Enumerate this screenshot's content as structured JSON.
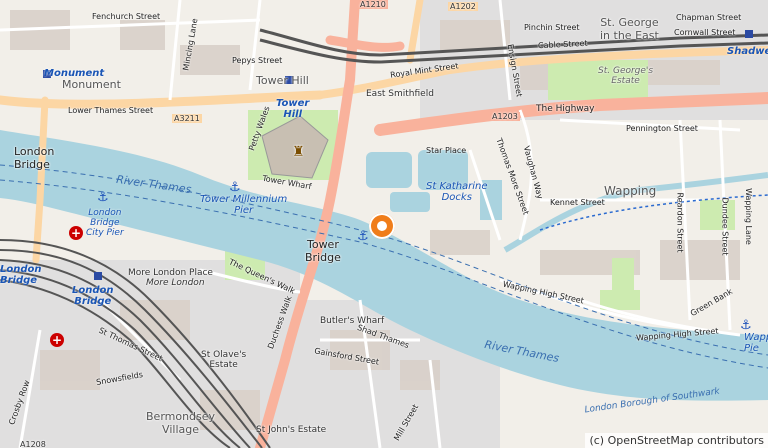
{
  "map": {
    "place_labels": {
      "monument_station": "Monument",
      "monument_area": "Monument",
      "london_bridge_area": "London\nBridge",
      "london_bridge_station": "London\nBridge",
      "london_bridge_city_pier": "London\nBridge\nCity Pier",
      "london_bridge_left": "London\nBridge",
      "tower_hill_area": "Tower Hill",
      "tower_hill_station": "Tower\nHill",
      "tower_bridge": "Tower\nBridge",
      "tower_millennium_pier": "Tower Millennium\nPier",
      "st_katharine_docks": "St Katharine\nDocks",
      "east_smithfield": "East Smithfield",
      "wapping": "Wapping",
      "st_george_in_the_east": "St. George\nin the East",
      "st_georges_estate": "St. George's\nEstate",
      "shadwell": "Shadwel",
      "more_london": "More London",
      "more_london_place": "More London Place",
      "butlers_wharf": "Butler's Wharf",
      "st_olaves_estate": "St Olave's\nEstate",
      "bermondsey_village": "Bermondsey\nVillage",
      "st_johns_estate": "St John's Estate",
      "wapping_pier": "Wappi\nPie",
      "lb_southwark": "London Borough of Southwark"
    },
    "river_labels": [
      "River Thames",
      "River Thames",
      "River Thames"
    ],
    "road_labels": {
      "a1210": "A1210",
      "a1202": "A1202",
      "a3211": "A3211",
      "a1203": "A1203",
      "a1208": "A1208"
    },
    "street_labels": {
      "fenchurch": "Fenchurch Street",
      "mincing": "Mincing Lane",
      "pepys": "Pepys Street",
      "lower_thames": "Lower Thames Street",
      "royal_mint": "Royal Mint Street",
      "cable": "Cable Street",
      "chapman": "Chapman Street",
      "cornwall": "Cornwall Street",
      "pinchin": "Pinchin Street",
      "the_highway": "The Highway",
      "pennington": "Pennington Street",
      "star_place": "Star Place",
      "thomas_more": "Thomas More Street",
      "vaughan": "Vaughan Way",
      "kennet": "Kennet Street",
      "reardon": "Reardon Street",
      "dundee": "Dundee Street",
      "wapping_lane": "Wapping Lane",
      "tower_wharf": "Tower Wharf",
      "petty_wales": "Petty Wales",
      "queens_walk": "The Queen's Walk",
      "duchess_walk": "Duchess Walk",
      "shad_thames": "Shad Thames",
      "gainsford": "Gainsford Street",
      "tooley": "St Thomas Street",
      "snowsfields": "Snowsfields",
      "crosby": "Crosby Row",
      "wapping_high": "Wapping High Street",
      "green_bank": "Green Bank",
      "mill_street": "Mill Street",
      "wapping_high_2": "Wapping High Street",
      "east_smithfield_st": "Ensign Street"
    },
    "colors": {
      "water": "#aad3df",
      "land": "#f2efe9",
      "primary_road": "#fcd6a4",
      "trunk_road": "#f9b29c",
      "motorway_rail": "#555555",
      "park": "#cdebb0",
      "building": "#d9d0c9",
      "marker": "#f07d1a"
    },
    "marker": {
      "icon": "map-pin-icon"
    }
  },
  "attribution": {
    "prefix": "(c) ",
    "link": "OpenStreetMap contributors"
  }
}
